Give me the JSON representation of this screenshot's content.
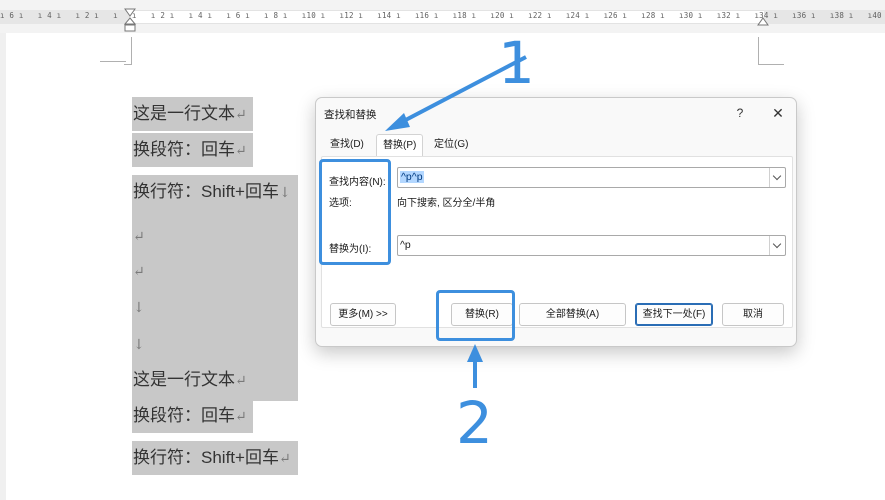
{
  "ruler": {
    "text": "ı 6 ı   ı 4 ı   ı 2 ı   ı   ı   ı 2 ı   ı 4 ı   ı 6 ı   ı 8 ı   ı10 ı   ı12 ı   ı14 ı   ı16 ı   ı18 ı   ı20 ı   ı22 ı   ı24 ı   ı26 ı   ı28 ı   ı30 ı   ı32 ı   ı34 ı   ı36 ı   ı38 ı   ı40 ı   ı42"
  },
  "document": {
    "lines": [
      {
        "text": "这是一行文本",
        "mark": "↵"
      },
      {
        "text": "换段符：回车",
        "mark": "↵"
      },
      {
        "text_a": "换行符：",
        "text_b": "Shift+",
        "text_c": "回车",
        "mark": "↓"
      },
      {
        "mark": "↵"
      },
      {
        "mark": "↵"
      },
      {
        "mark": "↓"
      },
      {
        "mark": "↓"
      },
      {
        "text": "这是一行文本",
        "mark": "↵"
      },
      {
        "text": "换段符：回车",
        "mark": "↵"
      },
      {
        "text_a": "换行符：",
        "text_b": "Shift+",
        "text_c": "回车",
        "mark": "↵"
      }
    ]
  },
  "dialog": {
    "title": "查找和替换",
    "help": "?",
    "close": "✕",
    "tabs": {
      "find": "查找(D)",
      "replace": "替换(P)",
      "goto": "定位(G)"
    },
    "find_label": "查找内容(N):",
    "find_value": "^p^p",
    "options_label": "选项:",
    "options_value": "向下搜索, 区分全/半角",
    "replace_label": "替换为(I):",
    "replace_value": "^p",
    "buttons": {
      "more": "更多(M) >>",
      "replace": "替换(R)",
      "replace_all": "全部替换(A)",
      "find_next": "查找下一处(F)",
      "cancel": "取消"
    }
  },
  "annotations": {
    "label_1": "1",
    "label_2": "2",
    "color": "#3d8fde"
  }
}
